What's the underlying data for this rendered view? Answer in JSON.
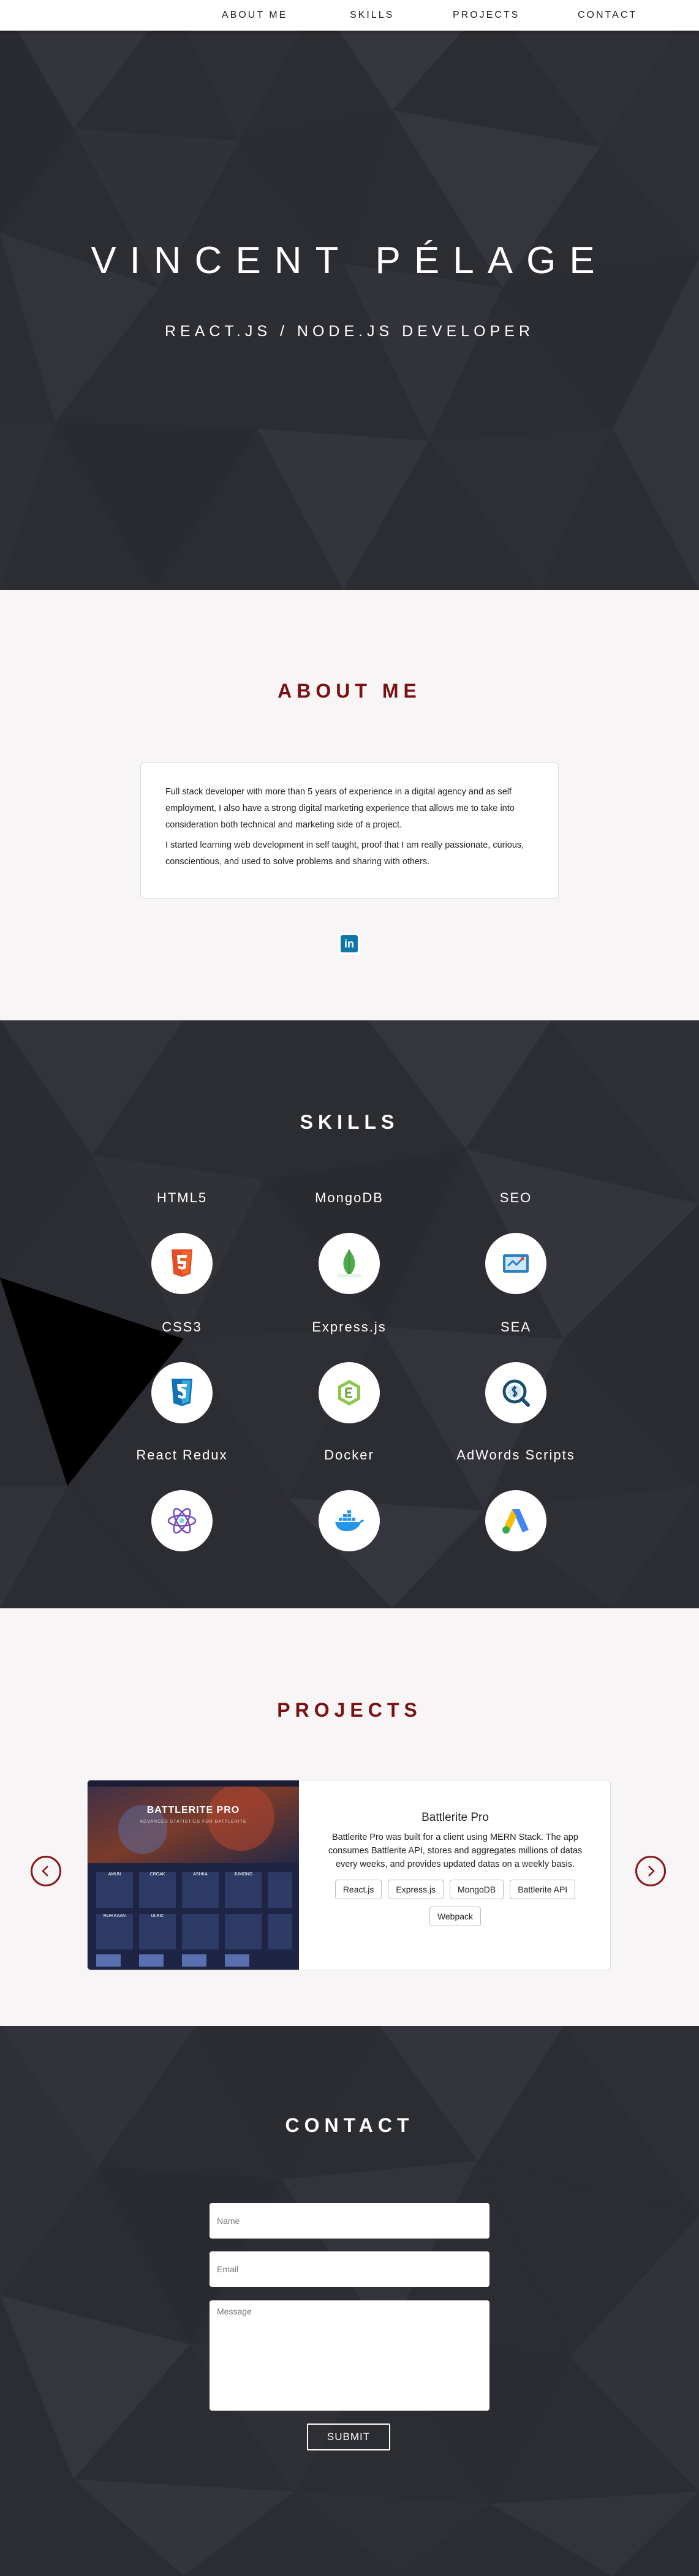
{
  "nav": {
    "about": "ABOUT ME",
    "skills": "SKILLS",
    "projects": "PROJECTS",
    "contact": "CONTACT"
  },
  "hero": {
    "name": "VINCENT PÉLAGE",
    "role": "REACT.JS / NODE.JS DEVELOPER"
  },
  "about": {
    "title": "ABOUT ME",
    "paragraphs": [
      "Full stack developer with more than 5 years of experience in a digital agency and as self employment, I also have a strong digital marketing experience that allows me to take into consideration both technical and marketing side of a project.",
      "I started learning web development in self taught, proof that I am really passionate, curious, conscientious, and used to solve problems and sharing with others."
    ],
    "linkedin_icon": "linkedin-icon",
    "linkedin_glyph": "in"
  },
  "skills": {
    "title": "SKILLS",
    "items": [
      {
        "label": "HTML5",
        "icon": "html5-icon"
      },
      {
        "label": "MongoDB",
        "icon": "mongodb-icon"
      },
      {
        "label": "SEO",
        "icon": "seo-icon"
      },
      {
        "label": "CSS3",
        "icon": "css3-icon"
      },
      {
        "label": "Express.js",
        "icon": "expressjs-icon"
      },
      {
        "label": "SEA",
        "icon": "sea-icon"
      },
      {
        "label": "React Redux",
        "icon": "react-redux-icon"
      },
      {
        "label": "Docker",
        "icon": "docker-icon"
      },
      {
        "label": "AdWords Scripts",
        "icon": "adwords-icon"
      }
    ]
  },
  "projects": {
    "title": "PROJECTS",
    "items": [
      {
        "name": "Battlerite Pro",
        "description": "Battlerite Pro was built for a client using MERN Stack. The app consumes Battlerite API, stores and aggregates millions of datas every weeks, and provides updated datas on a weekly basis.",
        "tags": [
          "React.js",
          "Express.js",
          "MongoDB",
          "Battlerite API",
          "Webpack"
        ],
        "image_logo": "BATTLERITE PRO",
        "image_subtitle": "ADVANCED STATISTICS FOR BATTLERITE",
        "image_tiles": [
          "AMUN",
          "CROAK",
          "ASHKA",
          "JUMONG",
          "RUH KAAN",
          "ULRIC"
        ]
      }
    ],
    "prev_icon": "chevron-left-icon",
    "next_icon": "chevron-right-icon"
  },
  "contact": {
    "title": "CONTACT",
    "name_placeholder": "Name",
    "email_placeholder": "Email",
    "message_placeholder": "Message",
    "submit": "SUBMIT"
  },
  "colors": {
    "dark_bg": "#2c2d33",
    "accent_red": "#7a1012",
    "light_bg": "#f7f5f5"
  }
}
